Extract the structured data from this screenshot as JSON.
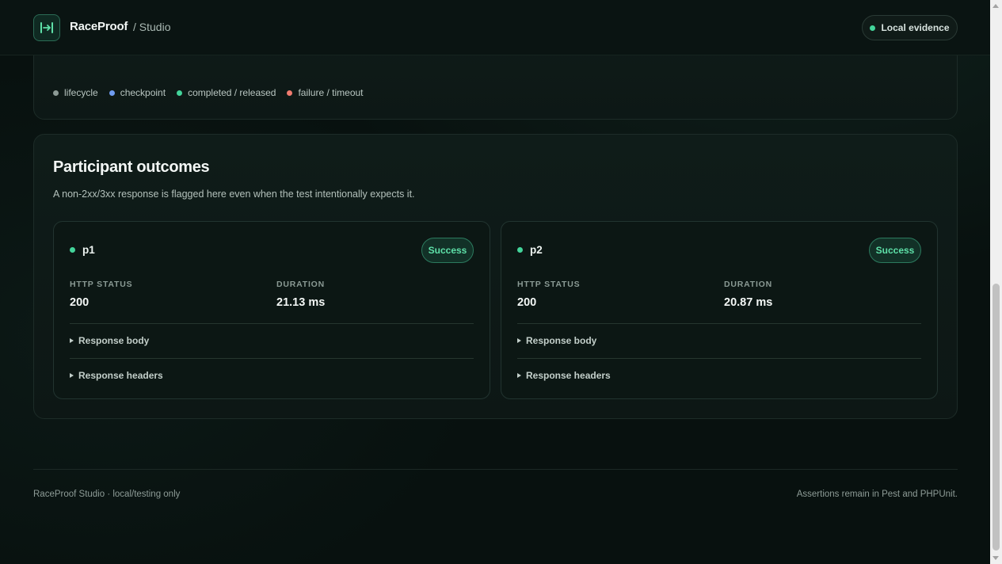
{
  "header": {
    "brand": "RaceProof",
    "crumb": "/ Studio",
    "evidence_label": "Local evidence",
    "logo_icon": "race-logo-icon"
  },
  "legend": {
    "items": [
      {
        "label": "lifecycle",
        "color": "#8c9a95"
      },
      {
        "label": "checkpoint",
        "color": "#6f9cf0"
      },
      {
        "label": "completed / released",
        "color": "#43d49a"
      },
      {
        "label": "failure / timeout",
        "color": "#f07b6f"
      }
    ]
  },
  "outcomes": {
    "title": "Participant outcomes",
    "subtitle": "A non-2xx/3xx response is flagged here even when the test intentionally expects it.",
    "participants": [
      {
        "name": "p1",
        "status_badge": "Success",
        "http_status_label": "HTTP STATUS",
        "http_status": "200",
        "duration_label": "DURATION",
        "duration": "21.13 ms",
        "response_body_label": "Response body",
        "response_headers_label": "Response headers"
      },
      {
        "name": "p2",
        "status_badge": "Success",
        "http_status_label": "HTTP STATUS",
        "http_status": "200",
        "duration_label": "DURATION",
        "duration": "20.87 ms",
        "response_body_label": "Response body",
        "response_headers_label": "Response headers"
      }
    ]
  },
  "footer": {
    "left": "RaceProof Studio · local/testing only",
    "right": "Assertions remain in Pest and PHPUnit."
  },
  "colors": {
    "accent": "#43d49a",
    "background": "#08110f"
  }
}
